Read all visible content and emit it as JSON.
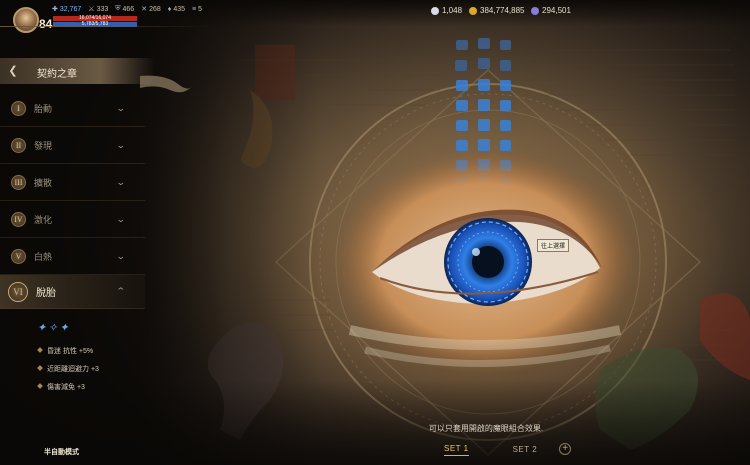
{
  "player": {
    "level": "84",
    "stats": [
      {
        "icon": "health-icon",
        "value": "32,767"
      },
      {
        "icon": "sword-icon",
        "value": "333"
      },
      {
        "icon": "shield-icon",
        "value": "466"
      },
      {
        "icon": "crossed-swords-icon",
        "value": "268"
      },
      {
        "icon": "potion-icon",
        "value": "435"
      },
      {
        "icon": "signal-icon",
        "value": "5"
      }
    ],
    "hp_bar": {
      "text": "16,074/16,074",
      "fill_fraction": 1.0,
      "color": "#b6281d"
    },
    "mp_bar": {
      "text": "5,783/5,783",
      "fill_fraction": 1.0,
      "color": "#2f5fb0"
    }
  },
  "currency": [
    {
      "icon": "diamond-icon",
      "value": "1,048",
      "color": "#d8dce6"
    },
    {
      "icon": "gold-coin-icon",
      "value": "384,774,885",
      "color": "#d9a72d"
    },
    {
      "icon": "gem-icon",
      "value": "294,501",
      "color": "#8b7bd9"
    }
  ],
  "panel": {
    "title": "契約之章"
  },
  "menu": [
    {
      "numeral": "I",
      "label": "胎動"
    },
    {
      "numeral": "II",
      "label": "發現"
    },
    {
      "numeral": "III",
      "label": "擴散"
    },
    {
      "numeral": "IV",
      "label": "激化"
    },
    {
      "numeral": "V",
      "label": "白熱"
    },
    {
      "numeral": "VI",
      "label": "脫胎",
      "active": true
    }
  ],
  "effects": {
    "items": [
      "昏迷 抗性 +5%",
      "近距離迴避力 +3",
      "傷害減免 +3"
    ]
  },
  "mode_button": "半自動模式",
  "tooltip": "往上選擇",
  "hint": "可以只套用開啟的魔眼組合效果.",
  "sets": [
    {
      "label": "SET 1",
      "active": true
    },
    {
      "label": "SET 2",
      "active": false
    }
  ]
}
